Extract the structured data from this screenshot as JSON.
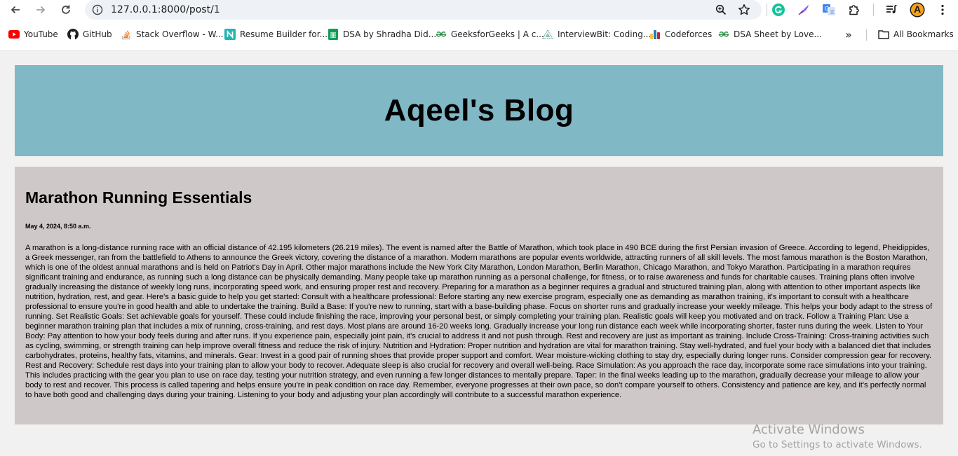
{
  "browser": {
    "url": "127.0.0.1:8000/post/1",
    "bookmarks": [
      {
        "label": "YouTube",
        "icon": "youtube-icon"
      },
      {
        "label": "GitHub",
        "icon": "github-icon"
      },
      {
        "label": "Stack Overflow - W...",
        "icon": "stackoverflow-icon"
      },
      {
        "label": "Resume Builder for...",
        "icon": "resume-builder-icon"
      },
      {
        "label": "DSA by Shradha Did...",
        "icon": "sheets-icon"
      },
      {
        "label": "GeeksforGeeks | A c...",
        "icon": "geeksforgeeks-icon"
      },
      {
        "label": "InterviewBit: Coding...",
        "icon": "interviewbit-icon"
      },
      {
        "label": "Codeforces",
        "icon": "codeforces-icon"
      },
      {
        "label": "DSA Sheet by Love...",
        "icon": "geeksforgeeks-icon"
      }
    ],
    "more_label": "»",
    "all_bookmarks_label": "All Bookmarks",
    "profile_initial": "A"
  },
  "blog": {
    "title": "Aqeel's Blog"
  },
  "post": {
    "title": "Marathon Running Essentials",
    "date": "May 4, 2024, 8:50 a.m.",
    "body": "A marathon is a long-distance running race with an official distance of 42.195 kilometers (26.219 miles). The event is named after the Battle of Marathon, which took place in 490 BCE during the first Persian invasion of Greece. According to legend, Pheidippides, a Greek messenger, ran from the battlefield to Athens to announce the Greek victory, covering the distance of a marathon. Modern marathons are popular events worldwide, attracting runners of all skill levels. The most famous marathon is the Boston Marathon, which is one of the oldest annual marathons and is held on Patriot's Day in April. Other major marathons include the New York City Marathon, London Marathon, Berlin Marathon, Chicago Marathon, and Tokyo Marathon. Participating in a marathon requires significant training and endurance, as running such a long distance can be physically demanding. Many people take up marathon running as a personal challenge, for fitness, or to raise awareness and funds for charitable causes. Training plans often involve gradually increasing the distance of weekly long runs, incorporating speed work, and ensuring proper rest and recovery. Preparing for a marathon as a beginner requires a gradual and structured training plan, along with attention to other important aspects like nutrition, hydration, rest, and gear. Here's a basic guide to help you get started: Consult with a healthcare professional: Before starting any new exercise program, especially one as demanding as marathon training, it's important to consult with a healthcare professional to ensure you're in good health and able to undertake the training. Build a Base: If you're new to running, start with a base-building phase. Focus on shorter runs and gradually increase your weekly mileage. This helps your body adapt to the stress of running. Set Realistic Goals: Set achievable goals for yourself. These could include finishing the race, improving your personal best, or simply completing your training plan. Realistic goals will keep you motivated and on track. Follow a Training Plan: Use a beginner marathon training plan that includes a mix of running, cross-training, and rest days. Most plans are around 16-20 weeks long. Gradually increase your long run distance each week while incorporating shorter, faster runs during the week. Listen to Your Body: Pay attention to how your body feels during and after runs. If you experience pain, especially joint pain, it's crucial to address it and not push through. Rest and recovery are just as important as training. Include Cross-Training: Cross-training activities such as cycling, swimming, or strength training can help improve overall fitness and reduce the risk of injury. Nutrition and Hydration: Proper nutrition and hydration are vital for marathon training. Stay well-hydrated, and fuel your body with a balanced diet that includes carbohydrates, proteins, healthy fats, vitamins, and minerals. Gear: Invest in a good pair of running shoes that provide proper support and comfort. Wear moisture-wicking clothing to stay dry, especially during longer runs. Consider compression gear for recovery. Rest and Recovery: Schedule rest days into your training plan to allow your body to recover. Adequate sleep is also crucial for recovery and overall well-being. Race Simulation: As you approach the race day, incorporate some race simulations into your training. This includes practicing with the gear you plan to use on race day, testing your nutrition strategy, and even running a few longer distances to mentally prepare. Taper: In the final weeks leading up to the marathon, gradually decrease your mileage to allow your body to rest and recover. This process is called tapering and helps ensure you're in peak condition on race day. Remember, everyone progresses at their own pace, so don't compare yourself to others. Consistency and patience are key, and it's perfectly normal to have both good and challenging days during your training. Listening to your body and adjusting your plan accordingly will contribute to a successful marathon experience."
  },
  "watermark": {
    "line1": "Activate Windows",
    "line2": "Go to Settings to activate Windows."
  },
  "colors": {
    "header_bg": "#81b8c5",
    "post_bg": "#cfc8c8",
    "page_bg": "#f1f1f1"
  }
}
